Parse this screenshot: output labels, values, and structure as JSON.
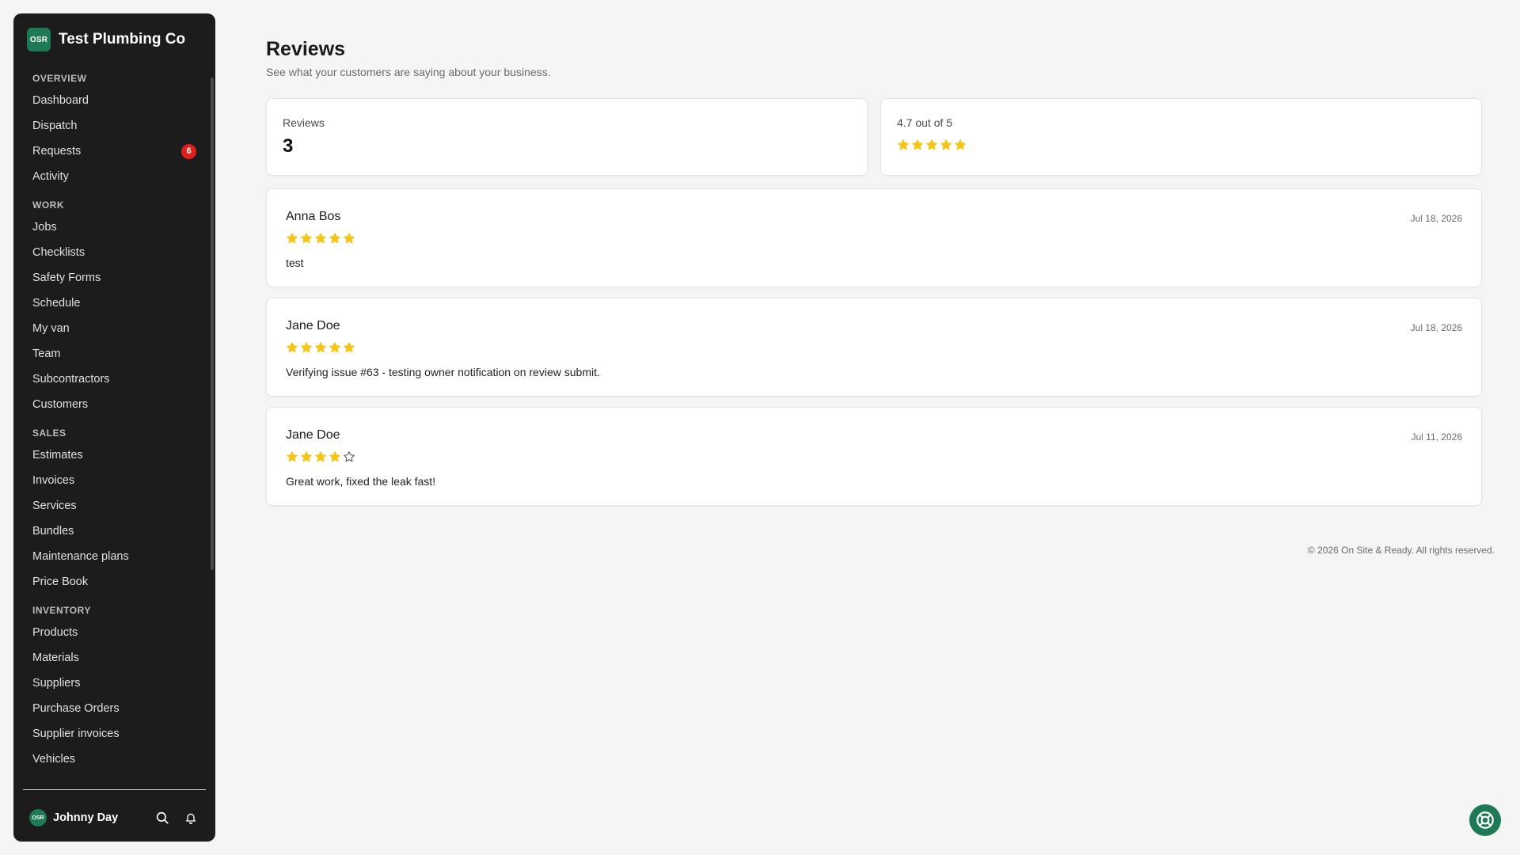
{
  "brand": {
    "logo_text": "OSR",
    "name": "Test Plumbing Co"
  },
  "nav": [
    {
      "title": "OVERVIEW",
      "items": [
        {
          "label": "Dashboard"
        },
        {
          "label": "Dispatch"
        },
        {
          "label": "Requests",
          "badge": "6"
        },
        {
          "label": "Activity"
        }
      ]
    },
    {
      "title": "WORK",
      "items": [
        {
          "label": "Jobs"
        },
        {
          "label": "Checklists"
        },
        {
          "label": "Safety Forms"
        },
        {
          "label": "Schedule"
        },
        {
          "label": "My van"
        },
        {
          "label": "Team"
        },
        {
          "label": "Subcontractors"
        },
        {
          "label": "Customers"
        }
      ]
    },
    {
      "title": "SALES",
      "items": [
        {
          "label": "Estimates"
        },
        {
          "label": "Invoices"
        },
        {
          "label": "Services"
        },
        {
          "label": "Bundles"
        },
        {
          "label": "Maintenance plans"
        },
        {
          "label": "Price Book"
        }
      ]
    },
    {
      "title": "INVENTORY",
      "items": [
        {
          "label": "Products"
        },
        {
          "label": "Materials"
        },
        {
          "label": "Suppliers"
        },
        {
          "label": "Purchase Orders"
        },
        {
          "label": "Supplier invoices"
        },
        {
          "label": "Vehicles"
        }
      ]
    }
  ],
  "user": {
    "avatar_text": "OSR",
    "name": "Johnny Day",
    "icons": [
      "search-icon",
      "bell-icon"
    ]
  },
  "page": {
    "title": "Reviews",
    "subtitle": "See what your customers are saying about your business."
  },
  "stats": {
    "count_label": "Reviews",
    "count_value": "3",
    "rating_label": "4.7 out of 5",
    "rating_stars": 5
  },
  "reviews": [
    {
      "author": "Anna Bos",
      "rating": 5,
      "text": "test",
      "date": "Jul 18, 2026"
    },
    {
      "author": "Jane Doe",
      "rating": 5,
      "text": "Verifying issue #63 - testing owner notification on review submit.",
      "date": "Jul 18, 2026"
    },
    {
      "author": "Jane Doe",
      "rating": 4,
      "text": "Great work, fixed the leak fast!",
      "date": "Jul 11, 2026"
    }
  ],
  "footer": {
    "text": "© 2026 On Site & Ready. All rights reserved."
  },
  "colors": {
    "sidebar_bg": "#1c1c1c",
    "brand_green": "#1e7a55",
    "star_gold": "#f5c518",
    "badge_red": "#e0201d",
    "page_bg": "#f5f5f5"
  },
  "help": {
    "icon": "lifebuoy-icon"
  }
}
